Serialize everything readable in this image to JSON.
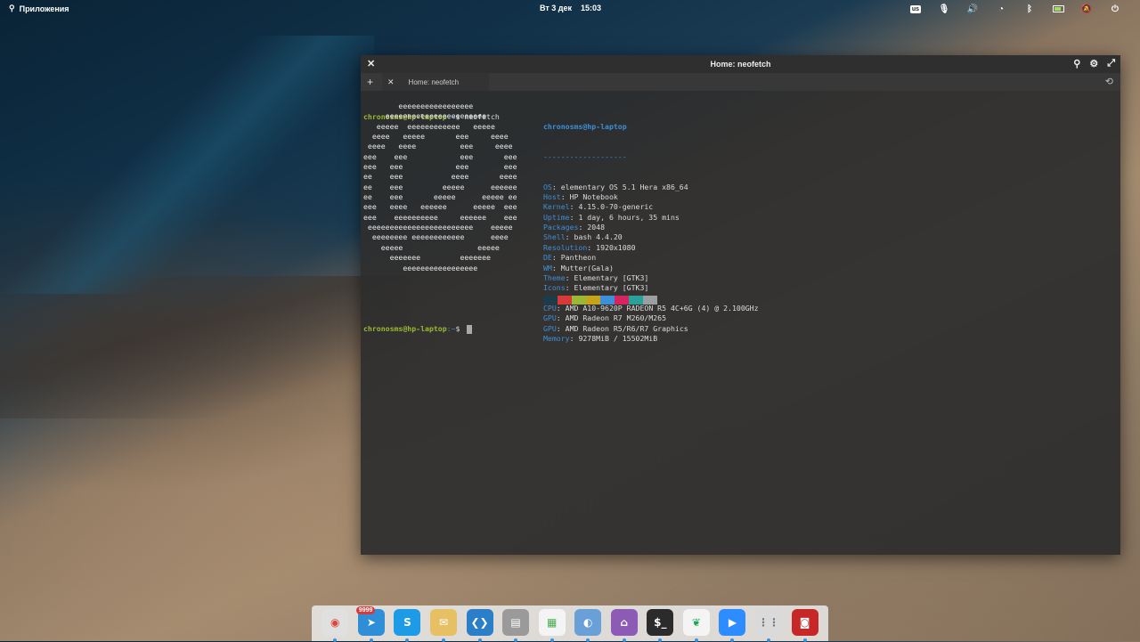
{
  "panel": {
    "apps_label": "Приложения",
    "date": "Вт  3 дек",
    "time": "15:03",
    "keyboard_layout": "us",
    "tray_icons": [
      "keyboard-layout-icon",
      "microphone-icon",
      "volume-icon",
      "wifi-icon",
      "bluetooth-icon",
      "battery-icon",
      "notifications-icon",
      "power-icon"
    ]
  },
  "window": {
    "title": "Home: neofetch",
    "tab_label": "Home: neofetch"
  },
  "terminal": {
    "prompt_user": "chronosms@hp-laptop",
    "prompt_path": ":~",
    "prompt_symbol": "$ ",
    "command": "neofetch",
    "logo_lines": [
      "        eeeeeeeeeeeeeeeee",
      "     eeeeeeeeeeeeeeeeeeeeeee",
      "   eeeee  eeeeeeeeeeee   eeeee",
      "  eeee   eeeee       eee     eeee",
      " eeee   eeee          eee     eeee",
      "eee    eee            eee       eee",
      "eee   eee            eee        eee",
      "ee    eee           eeee       eeee",
      "ee    eee         eeeee      eeeeee",
      "ee    eee       eeeee      eeeee ee",
      "eee   eeee   eeeeee      eeeee  eee",
      "eee    eeeeeeeeee     eeeeee    eee",
      " eeeeeeeeeeeeeeeeeeeeeeee    eeeee",
      "  eeeeeeee eeeeeeeeeeee      eeee",
      "    eeeee                 eeeee",
      "      eeeeeee         eeeeeee",
      "         eeeeeeeeeeeeeeeee"
    ],
    "user_host": "chronosms@hp-laptop",
    "separator": "-------------------",
    "info": [
      {
        "key": "OS",
        "value": "elementary OS 5.1 Hera x86_64"
      },
      {
        "key": "Host",
        "value": "HP Notebook"
      },
      {
        "key": "Kernel",
        "value": "4.15.0-70-generic"
      },
      {
        "key": "Uptime",
        "value": "1 day, 6 hours, 35 mins"
      },
      {
        "key": "Packages",
        "value": "2048"
      },
      {
        "key": "Shell",
        "value": "bash 4.4.20"
      },
      {
        "key": "Resolution",
        "value": "1920x1080"
      },
      {
        "key": "DE",
        "value": "Pantheon"
      },
      {
        "key": "WM",
        "value": "Mutter(Gala)"
      },
      {
        "key": "Theme",
        "value": "Elementary [GTK3]"
      },
      {
        "key": "Icons",
        "value": "Elementary [GTK3]"
      },
      {
        "key": "Terminal",
        "value": "io.elementary.t"
      },
      {
        "key": "CPU",
        "value": "AMD A10-9620P RADEON R5 4C+6G (4) @ 2.100GHz"
      },
      {
        "key": "GPU",
        "value": "AMD Radeon R7 M260/M265"
      },
      {
        "key": "GPU",
        "value": "AMD Radeon R5/R6/R7 Graphics"
      },
      {
        "key": "Memory",
        "value": "9278MiB / 15502MiB"
      }
    ],
    "palette": [
      "#1d3b4a",
      "#d83a3a",
      "#9ab833",
      "#c5a41a",
      "#3d8fd8",
      "#d6245e",
      "#2aa198",
      "#9aa0a0"
    ]
  },
  "dock": {
    "apps": [
      {
        "name": "chrome-icon",
        "color": "#e0e0e0",
        "glyph": "◉",
        "glyph_color": "#db4437"
      },
      {
        "name": "telegram-icon",
        "color": "#2f8ed8",
        "glyph": "➤",
        "badge": "9999"
      },
      {
        "name": "skype-icon",
        "color": "#1e9be6",
        "glyph": "S"
      },
      {
        "name": "mail-icon",
        "color": "#e7c064",
        "glyph": "✉"
      },
      {
        "name": "vscode-icon",
        "color": "#2b7fc9",
        "glyph": "❮❯"
      },
      {
        "name": "files-icon",
        "color": "#9a9a9a",
        "glyph": "▤"
      },
      {
        "name": "calendar-icon",
        "color": "#f4f4f4",
        "glyph": "▦",
        "glyph_color": "#4caf50"
      },
      {
        "name": "settings-icon",
        "color": "#6aa0d8",
        "glyph": "◐"
      },
      {
        "name": "appcenter-icon",
        "color": "#8b5bb5",
        "glyph": "⌂"
      },
      {
        "name": "terminal-icon",
        "color": "#2b2b2b",
        "glyph": "$_"
      },
      {
        "name": "mongodb-compass-icon",
        "color": "#f4f4f4",
        "glyph": "❦",
        "glyph_color": "#13aa52"
      },
      {
        "name": "zoom-icon",
        "color": "#2d8cff",
        "glyph": "▶"
      },
      {
        "name": "workspaces-icon",
        "color": "#dadada",
        "glyph": "⋮⋮",
        "glyph_color": "#777777"
      },
      {
        "name": "screen-recorder-icon",
        "color": "#c62828",
        "glyph": "◙"
      }
    ]
  }
}
